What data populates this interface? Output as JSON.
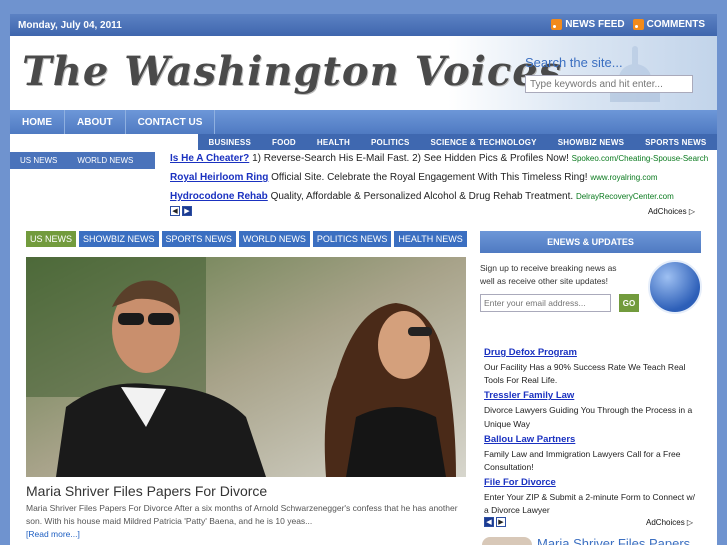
{
  "topbar": {
    "date": "Monday, July 04, 2011",
    "news_feed": "NEWS FEED",
    "comments": "COMMENTS"
  },
  "header": {
    "logo": "The Washington Voices",
    "search_label": "Search the site...",
    "search_placeholder": "Type keywords and hit enter..."
  },
  "nav": {
    "items": [
      "HOME",
      "ABOUT",
      "CONTACT US"
    ]
  },
  "categories": [
    "BUSINESS",
    "FOOD",
    "HEALTH",
    "POLITICS",
    "SCIENCE & TECHNOLOGY",
    "SHOWBIZ NEWS",
    "SPORTS NEWS"
  ],
  "subnav": [
    "US NEWS",
    "WORLD NEWS"
  ],
  "ads": [
    {
      "title": "Is He A Cheater?",
      "text": " 1) Reverse-Search His E-Mail Fast. 2) See Hidden Pics & Profiles Now! ",
      "url": "Spokeo.com/Cheating-Spouse-Search"
    },
    {
      "title": "Royal Heirloom Ring",
      "text": " Official Site. Celebrate the Royal Engagement With This Timeless Ring! ",
      "url": "www.royalring.com"
    },
    {
      "title": "Hydrocodone Rehab",
      "text": " Quality, Affordable & Personalized Alcohol & Drug Rehab Treatment. ",
      "url": "DelrayRecoveryCenter.com"
    }
  ],
  "adchoices": "AdChoices",
  "tabs": [
    "US NEWS",
    "SHOWBIZ NEWS",
    "SPORTS NEWS",
    "WORLD NEWS",
    "POLITICS NEWS",
    "HEALTH NEWS"
  ],
  "feature": {
    "headline": "Maria Shriver Files Papers For Divorce",
    "excerpt": "Maria Shriver Files Papers For Divorce After a six months of Arnold Schwarzenegger's confess that he has another son. With his house maid Mildred Patricia 'Patty' Baena, and he is 10 yeas...",
    "read_more": "[Read more...]"
  },
  "enews": {
    "title": "ENEWS & UPDATES",
    "text": "Sign up to receive breaking news as well as receive other site updates!",
    "email_placeholder": "Enter your email address...",
    "go": "GO"
  },
  "sidebar_ads": [
    {
      "title": "Drug Defox Program",
      "desc": "Our Facility Has a 90% Success Rate We Teach Real Tools For Real Life."
    },
    {
      "title": "Tressler Family Law",
      "desc": "Divorce Lawyers Guiding You Through the Process in a Unique Way"
    },
    {
      "title": "Ballou Law Partners",
      "desc": "Family Law and Immigration Lawyers Call for a Free Consultation!"
    },
    {
      "title": "File For Divorce",
      "desc": "Enter Your ZIP & Submit a 2-minute Form to Connect w/ a Divorce Lawyer"
    }
  ],
  "related": {
    "title": "Maria Shriver Files Papers"
  },
  "colors": {
    "background": "#6f93cf",
    "nav": "#4f7ac2",
    "accent_green": "#729b3d",
    "link": "#1a31c0"
  }
}
